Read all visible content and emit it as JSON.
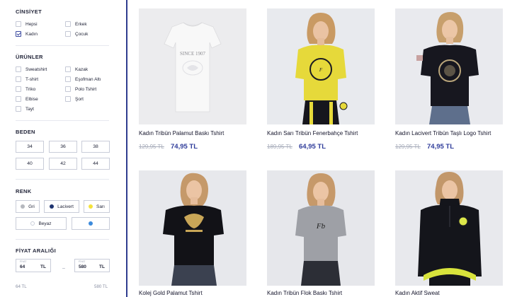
{
  "filters": {
    "gender": {
      "title": "CİNSİYET",
      "options": [
        {
          "label": "Hepsi",
          "checked": false
        },
        {
          "label": "Erkek",
          "checked": false
        },
        {
          "label": "Kadın",
          "checked": true
        },
        {
          "label": "Çocuk",
          "checked": false
        }
      ]
    },
    "products": {
      "title": "ÜRÜNLER",
      "options": [
        {
          "label": "Sweatshirt"
        },
        {
          "label": "Kazak"
        },
        {
          "label": "T-shirt"
        },
        {
          "label": "Eşofman Altı"
        },
        {
          "label": "Triko"
        },
        {
          "label": "Polo Tshirt"
        },
        {
          "label": "Elbise"
        },
        {
          "label": "Şort"
        },
        {
          "label": "Tayt"
        }
      ]
    },
    "size": {
      "title": "BEDEN",
      "options": [
        "34",
        "36",
        "38",
        "40",
        "42",
        "44"
      ]
    },
    "color": {
      "title": "RENK",
      "options": [
        {
          "label": "Gri",
          "color": "#b5b8be"
        },
        {
          "label": "Lacivert",
          "color": "#1f3470"
        },
        {
          "label": "Sarı",
          "color": "#f4e23c"
        },
        {
          "label": "Beyaz",
          "color": "#ffffff"
        },
        {
          "label": "",
          "color": "#3d8bdc"
        }
      ]
    },
    "price": {
      "title": "FİYAT ARALIĞI",
      "min_caption": "FİYAT",
      "max_caption": "FİYAT",
      "min_value": "64",
      "max_value": "580",
      "currency": "TL",
      "range_min_label": "64 TL",
      "range_max_label": "580 TL"
    }
  },
  "products": [
    {
      "name": "Kadın Tribün Palamut Baskı Tshirt",
      "old_price": "129,95 TL",
      "new_price": "74,95 TL",
      "shirt_color": "#f4f4f4",
      "graphic_text": "SINCE 1907"
    },
    {
      "name": "Kadın Sarı Tribün Fenerbahçe Tshirt",
      "old_price": "189,95 TL",
      "new_price": "64,95 TL",
      "shirt_color": "#e6d93a"
    },
    {
      "name": "Kadın Lacivert Tribün Taşlı Logo Tshirt",
      "old_price": "129,95 TL",
      "new_price": "74,95 TL",
      "shirt_color": "#17171f"
    },
    {
      "name": "Kolej Gold Palamut Tshirt",
      "shirt_color": "#121217"
    },
    {
      "name": "Kadın Tribün Flok Baskı Tshirt",
      "shirt_color": "#9ea0a6"
    },
    {
      "name": "Kadın Aktif Sweat",
      "shirt_color": "#14151b"
    }
  ],
  "colors": {
    "accent": "#2f3c9a",
    "divider_line": "#2f3c8f",
    "strike_price": "#a7acba"
  }
}
